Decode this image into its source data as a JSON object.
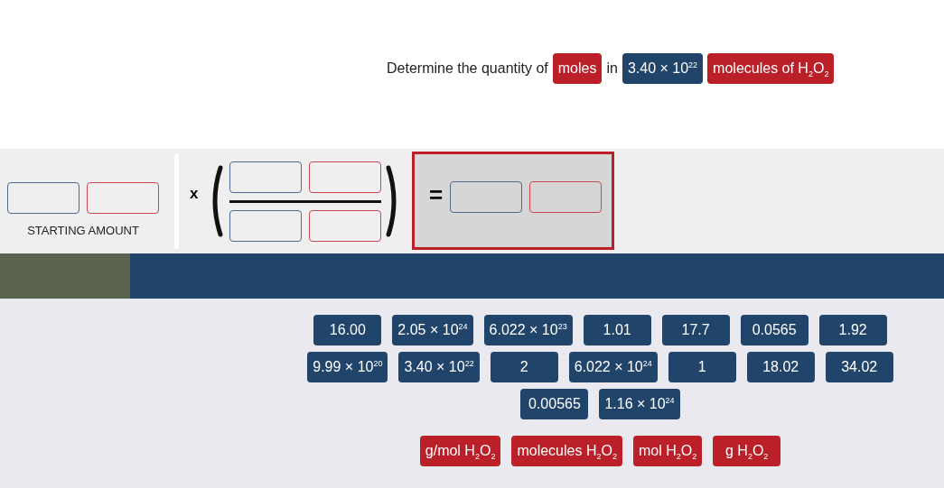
{
  "prompt": [
    {
      "kind": "text",
      "text": "Determine the quantity of"
    },
    {
      "kind": "unit",
      "text": "moles"
    },
    {
      "kind": "text",
      "text": "in"
    },
    {
      "kind": "number",
      "text": "3.40 × 10$^{22}$"
    },
    {
      "kind": "unit",
      "text": "molecules of H$_{2}$O$_{2}$"
    }
  ],
  "starting_amount": {
    "label": "STARTING AMOUNT",
    "slots": [
      {
        "kind": "number"
      },
      {
        "kind": "unit"
      }
    ]
  },
  "multiply_sign": "x",
  "factor": {
    "numerator": [
      {
        "kind": "number"
      },
      {
        "kind": "unit"
      }
    ],
    "denominator": [
      {
        "kind": "number"
      },
      {
        "kind": "unit"
      }
    ]
  },
  "equals_sign": "=",
  "result": {
    "slots": [
      {
        "kind": "number"
      },
      {
        "kind": "unit"
      }
    ]
  },
  "number_tiles": [
    [
      "16.00",
      "2.05 × 10$^{24}$",
      "6.022 × 10$^{23}$",
      "1.01",
      "17.7",
      "0.0565",
      "1.92"
    ],
    [
      "9.99 × 10$^{20}$",
      "3.40 × 10$^{22}$",
      "2",
      "6.022 × 10$^{24}$",
      "1",
      "18.02",
      "34.02"
    ],
    [
      "0.00565",
      "1.16 × 10$^{24}$"
    ]
  ],
  "unit_tiles": [
    "g/mol H$_{2}$O$_{2}$",
    "molecules H$_{2}$O$_{2}$",
    "mol H$_{2}$O$_{2}$",
    "g H$_{2}$O$_{2}$"
  ]
}
